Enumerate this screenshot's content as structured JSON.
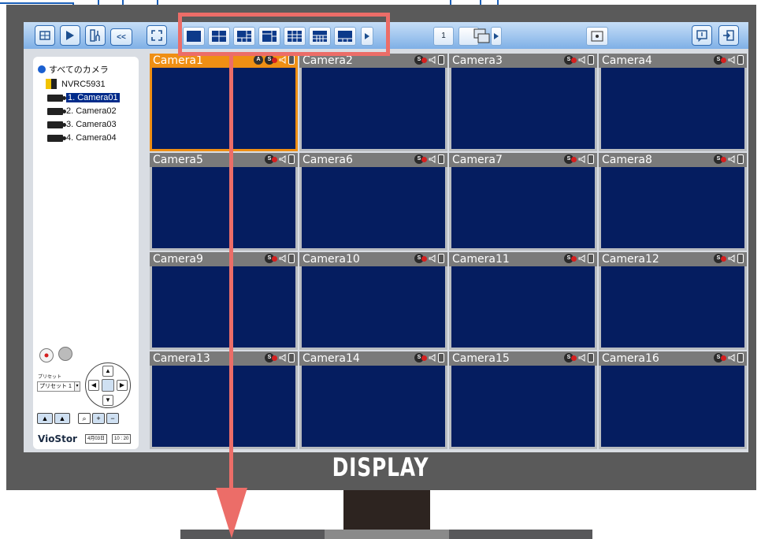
{
  "toolbar": {
    "page_number": "1",
    "buttons": [
      {
        "name": "monitor-view-icon"
      },
      {
        "name": "playback-icon"
      },
      {
        "name": "settings-icon"
      },
      {
        "name": "collapse-icon",
        "label": "<<"
      },
      {
        "name": "fullscreen-icon"
      }
    ],
    "layouts": [
      "layout-1",
      "layout-4",
      "layout-6",
      "layout-8",
      "layout-9",
      "layout-10",
      "layout-12",
      "more"
    ]
  },
  "tree": {
    "root": "すべてのカメラ",
    "nvr": "NVRC5931",
    "cameras": [
      "1. Camera01",
      "2. Camera02",
      "3. Camera03",
      "4. Camera04"
    ]
  },
  "ptz": {
    "preset_label": "プリセット",
    "preset_value": "プリセット 1",
    "brand": "VioStor",
    "date": "4月03日",
    "time": "10 : 20"
  },
  "cameras": [
    "Camera1",
    "Camera2",
    "Camera3",
    "Camera4",
    "Camera5",
    "Camera6",
    "Camera7",
    "Camera8",
    "Camera9",
    "Camera10",
    "Camera11",
    "Camera12",
    "Camera13",
    "Camera14",
    "Camera15",
    "Camera16"
  ],
  "display_label": "DISPLAY",
  "colors": {
    "accent": "#ec6d68",
    "active_tile": "#ef8f14",
    "video_bg": "#051d60",
    "toolbar": "#9fc5ee"
  }
}
